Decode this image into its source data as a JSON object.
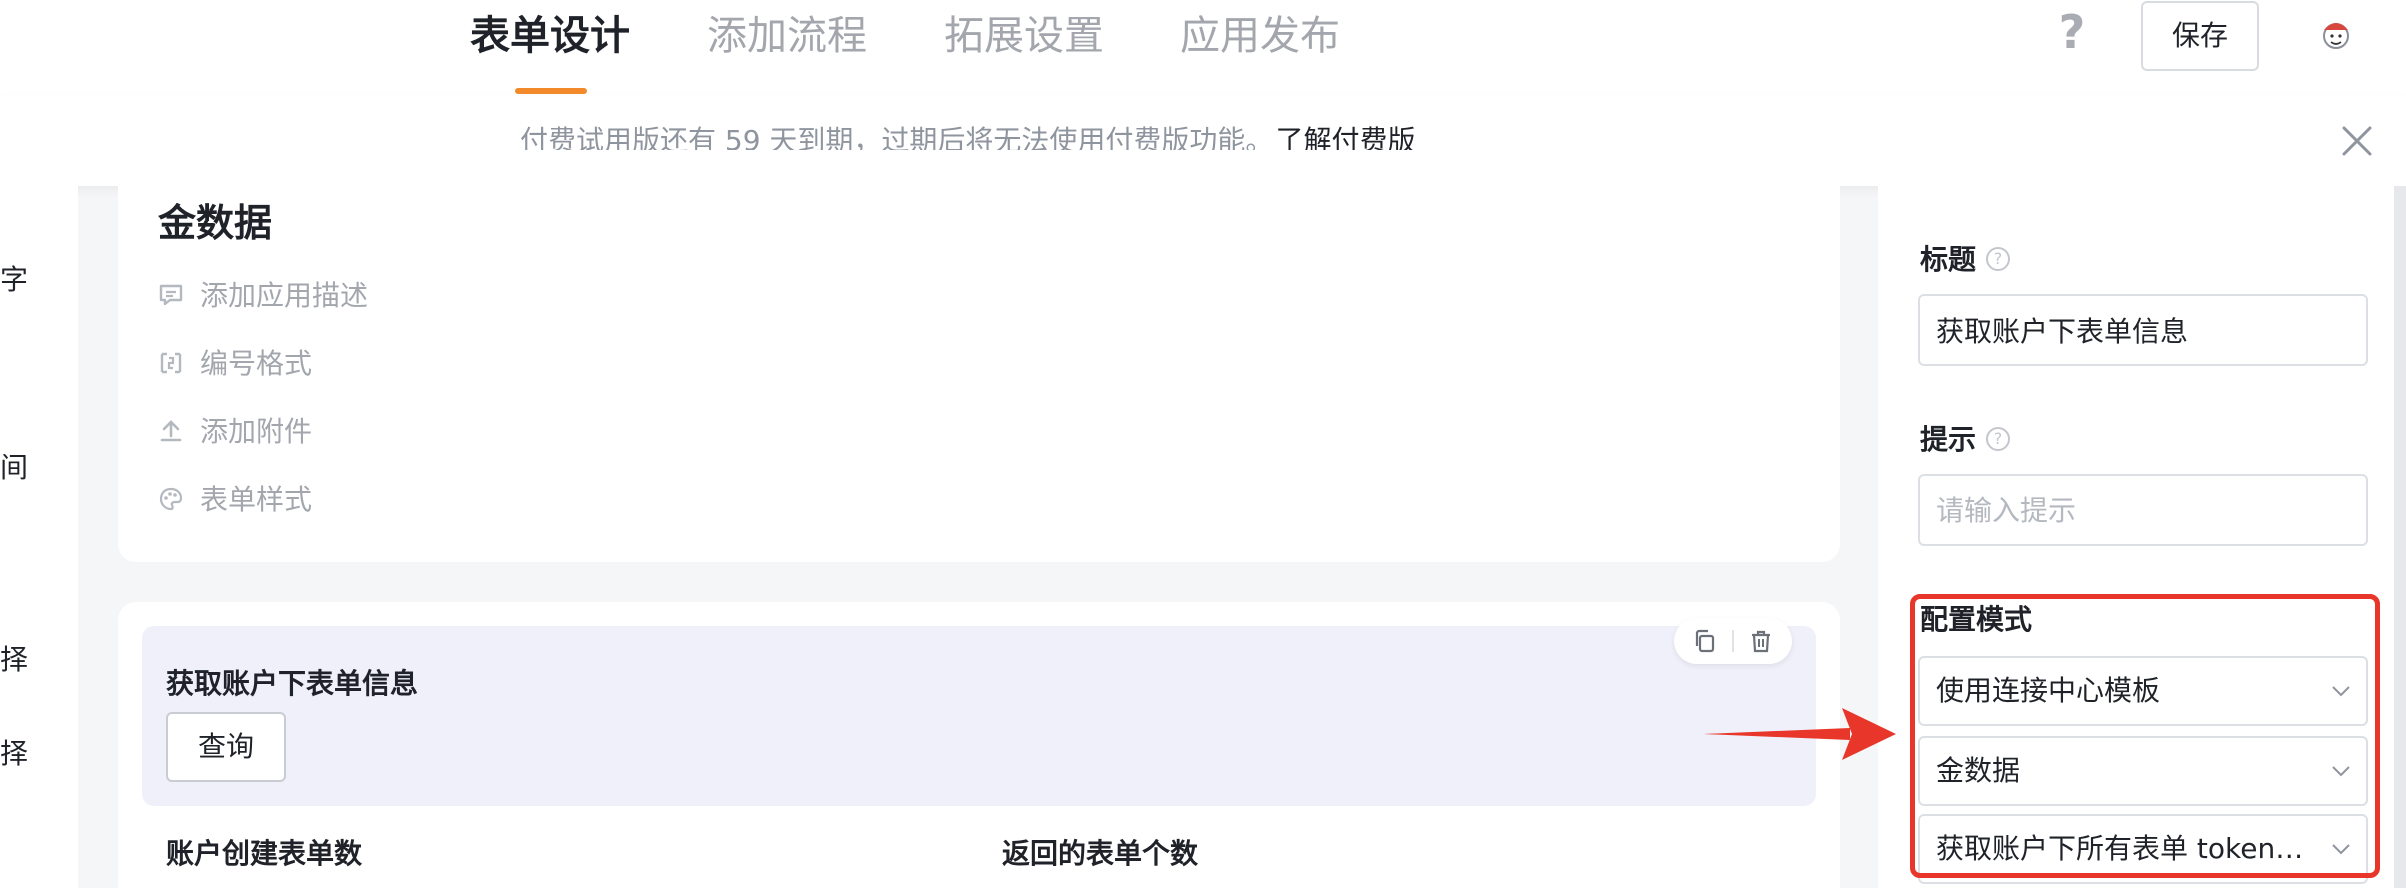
{
  "header": {
    "tabs": [
      {
        "label": "表单设计",
        "active": true
      },
      {
        "label": "添加流程",
        "active": false
      },
      {
        "label": "拓展设置",
        "active": false
      },
      {
        "label": "应用发布",
        "active": false
      }
    ],
    "help_icon": "?",
    "save_label": "保存",
    "accent_color": "#f28a2c"
  },
  "notice": {
    "text": "付费试用版还有 59 天到期，过期后将无法使用付费版功能。",
    "link": "了解付费版"
  },
  "left_rail": {
    "chars": [
      "字",
      "间",
      "择",
      "择"
    ]
  },
  "app_card": {
    "title": "金数据",
    "items": [
      {
        "icon": "comment-icon",
        "label": "添加应用描述"
      },
      {
        "icon": "number-format-icon",
        "label": "编号格式"
      },
      {
        "icon": "upload-icon",
        "label": "添加附件"
      },
      {
        "icon": "palette-icon",
        "label": "表单样式"
      }
    ]
  },
  "widget": {
    "title": "获取账户下表单信息",
    "button_label": "查询"
  },
  "fields": {
    "left_label": "账户创建表单数",
    "right_label": "返回的表单个数"
  },
  "settings": {
    "title_label": "标题",
    "title_value": "获取账户下表单信息",
    "hint_label": "提示",
    "hint_placeholder": "请输入提示",
    "mode_label": "配置模式",
    "mode_value": "使用连接中心模板",
    "connector_value": "金数据",
    "action_value": "获取账户下所有表单 token ...",
    "highlight_color": "#e8362a"
  }
}
